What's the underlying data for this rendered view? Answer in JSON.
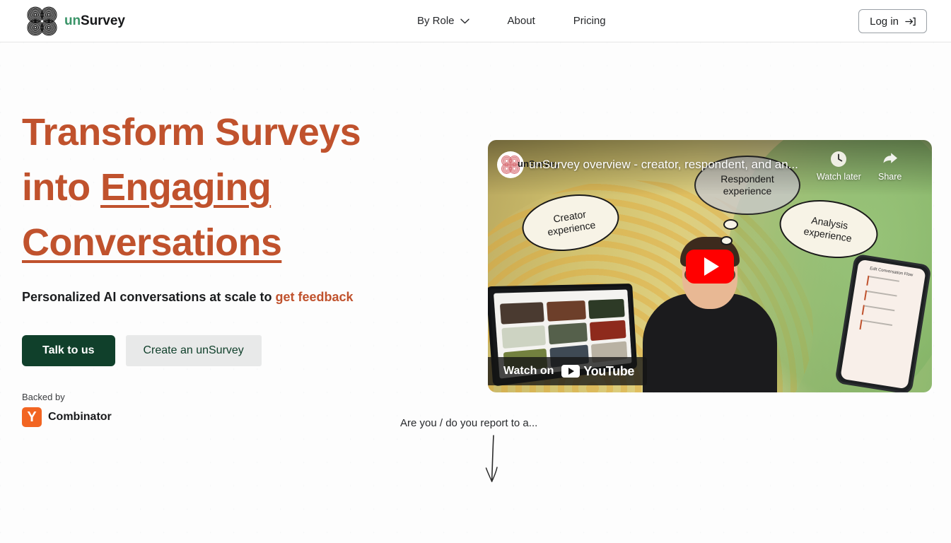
{
  "header": {
    "logo_icon": "unsurvey-concentric-circles-logo",
    "brand_prefix": "un",
    "brand_suffix": "Survey",
    "nav": [
      {
        "label": "By Role",
        "icon": "chevron-down-icon",
        "has_dropdown": true
      },
      {
        "label": "About",
        "has_dropdown": false
      },
      {
        "label": "Pricing",
        "has_dropdown": false
      }
    ],
    "login": {
      "label": "Log in",
      "icon": "login-arrow-icon"
    }
  },
  "hero": {
    "headline_line1": "Transform Surveys",
    "headline_line2_plain": "into ",
    "headline_line2_underlined": "Engaging",
    "headline_line3_underlined": "Conversations",
    "subheading_plain": "Personalized AI conversations at scale to ",
    "subheading_accent": "get feedback",
    "primary_cta": "Talk to us",
    "secondary_cta": "Create an unSurvey",
    "backed_by_label": "Backed by",
    "backer_mark": "Y",
    "backer_name": "Combinator",
    "colors": {
      "headline": "#c0522d",
      "accent": "#c0522d",
      "primary_button_bg": "#10402b",
      "secondary_button_bg": "#e8e9e9",
      "brand_green": "#3a9468",
      "yc_orange": "#f26522"
    }
  },
  "video": {
    "channel_name": "unSurvey",
    "title": "unSurvey overview - creator, respondent, and an...",
    "watch_later_label": "Watch later",
    "watch_later_icon": "clock-icon",
    "share_label": "Share",
    "share_icon": "share-arrow-icon",
    "play_icon": "youtube-play-button",
    "watch_on_label": "Watch on",
    "youtube_wordmark": "YouTube",
    "bubbles": [
      {
        "line1": "Creator",
        "line2": "experience"
      },
      {
        "line1": "Respondent",
        "line2": "experience"
      },
      {
        "line1": "Analysis",
        "line2": "experience"
      }
    ],
    "phone_screen_title": "Edit Conversation Flow"
  },
  "scroll_section": {
    "prompt": "Are you / do you report to a...",
    "arrow_icon": "hand-drawn-down-arrow-icon"
  }
}
